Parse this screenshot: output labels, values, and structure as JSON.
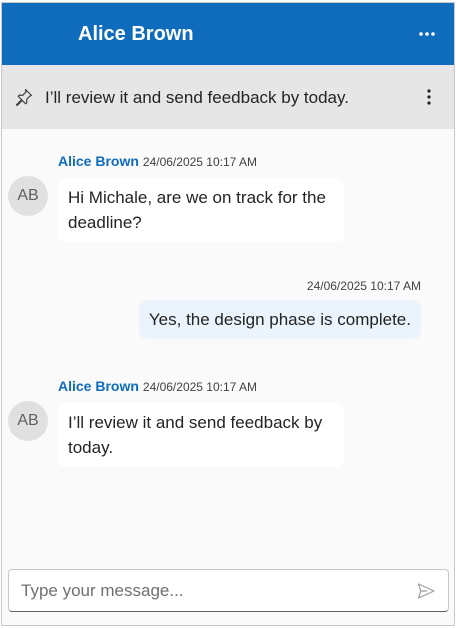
{
  "header": {
    "title": "Alice Brown",
    "more_icon": "more-horizontal-icon"
  },
  "pinned": {
    "icon": "pin-icon",
    "text": "I’ll review it and send feedback by today.",
    "more_icon": "more-vertical-icon"
  },
  "messages": [
    {
      "direction": "incoming",
      "author": "Alice Brown",
      "timestamp": "24/06/2025 10:17 AM",
      "avatar_initials": "AB",
      "text": "Hi Michale, are we on track for the deadline?"
    },
    {
      "direction": "outgoing",
      "timestamp": "24/06/2025 10:17 AM",
      "text": "Yes, the design phase is complete."
    },
    {
      "direction": "incoming",
      "author": "Alice Brown",
      "timestamp": "24/06/2025 10:17 AM",
      "avatar_initials": "AB",
      "text": "I’ll review it and send feedback by today."
    }
  ],
  "composer": {
    "placeholder": "Type your message...",
    "value": "",
    "send_icon": "send-icon"
  },
  "colors": {
    "accent": "#0f6cbd",
    "outgoing_bubble": "#ebf3fc",
    "pinned_bar": "#e6e6e6"
  }
}
